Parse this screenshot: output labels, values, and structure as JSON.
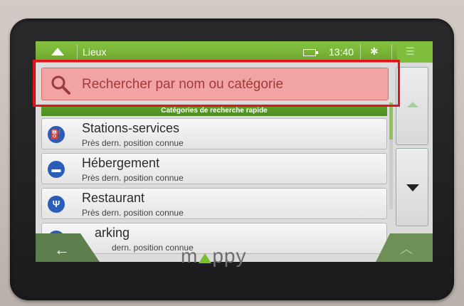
{
  "topbar": {
    "title": "Lieux",
    "time": "13:40",
    "bluetooth_glyph": "✱"
  },
  "search": {
    "placeholder": "Rechercher par nom ou catégorie"
  },
  "section_title": "Catégories de recherche rapide",
  "categories": [
    {
      "name": "Stations-services",
      "sub": "Près dern. position connue",
      "icon": "gas-station-icon",
      "glyph": "⛽"
    },
    {
      "name": "Hébergement",
      "sub": "Près dern. position connue",
      "icon": "bed-icon",
      "glyph": "▬"
    },
    {
      "name": "Restaurant",
      "sub": "Près dern. position connue",
      "icon": "fork-knife-icon",
      "glyph": "Ψ"
    },
    {
      "name": "arking",
      "sub": "dern. position connue",
      "icon": "parking-icon",
      "glyph": "P"
    }
  ],
  "bottom": {
    "back_glyph": "←",
    "up_glyph": "︿"
  },
  "logo": {
    "text_left": "m",
    "text_right": "ppy"
  },
  "colors": {
    "accent_green": "#6aa52d",
    "highlight_red": "#e0141a",
    "category_icon_blue": "#2a5db8"
  }
}
